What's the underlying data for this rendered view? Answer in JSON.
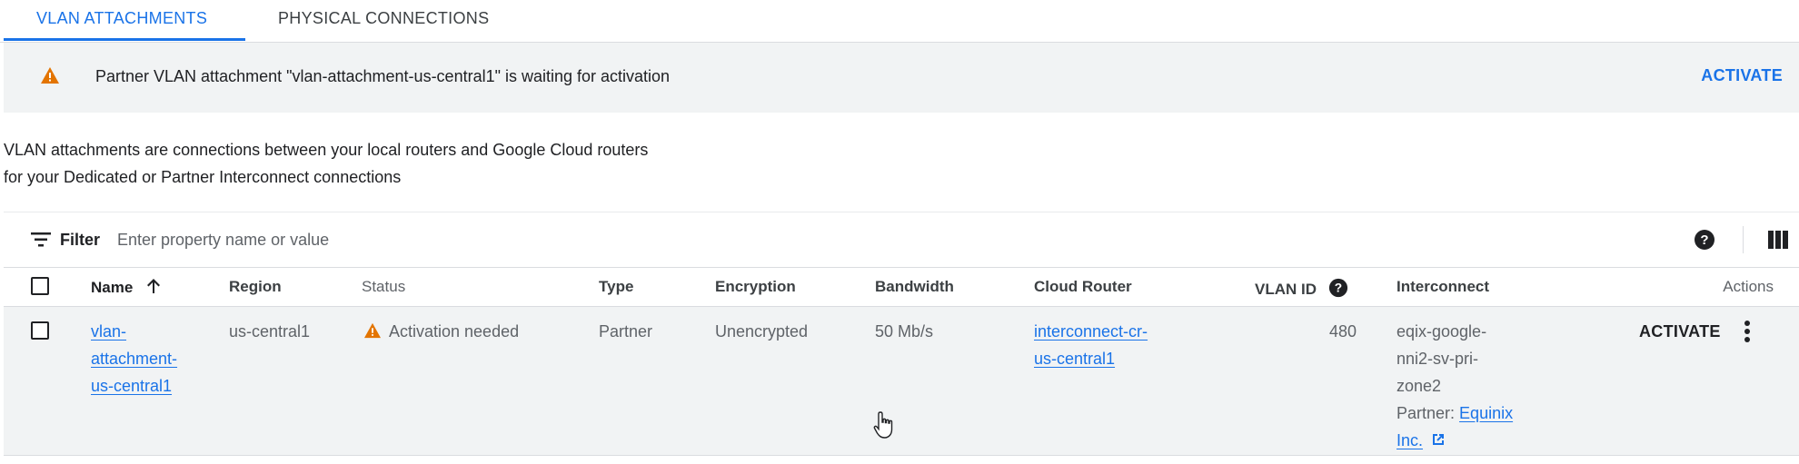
{
  "tabs": [
    {
      "label": "VLAN ATTACHMENTS",
      "active": true
    },
    {
      "label": "PHYSICAL CONNECTIONS",
      "active": false
    }
  ],
  "banner": {
    "icon": "warning-icon",
    "message": "Partner VLAN attachment \"vlan-attachment-us-central1\" is waiting for activation",
    "action_label": "ACTIVATE"
  },
  "description": {
    "line1": "VLAN attachments are connections between your local routers and Google Cloud routers",
    "line2": "for your Dedicated or Partner Interconnect connections"
  },
  "filter": {
    "label": "Filter",
    "placeholder": "Enter property name or value",
    "value": ""
  },
  "table": {
    "columns": {
      "name": "Name",
      "region": "Region",
      "status": "Status",
      "type": "Type",
      "encryption": "Encryption",
      "bandwidth": "Bandwidth",
      "cloud_router": "Cloud Router",
      "vlan_id": "VLAN ID",
      "interconnect": "Interconnect",
      "actions": "Actions"
    },
    "sort": {
      "column": "name",
      "direction": "ascending"
    },
    "rows": [
      {
        "name_lines": [
          "vlan-",
          "attachment-",
          "us-central1"
        ],
        "region": "us-central1",
        "status": "Activation needed",
        "type": "Partner",
        "encryption": "Unencrypted",
        "bandwidth": "50 Mb/s",
        "cloud_router_lines": [
          "interconnect-cr-",
          "us-central1"
        ],
        "vlan_id": "480",
        "interconnect_lines": [
          "eqix-google-",
          "nni2-sv-pri-",
          "zone2"
        ],
        "partner_label": "Partner:",
        "partner_name_lines": [
          "Equinix",
          "Inc."
        ],
        "action_label": "ACTIVATE"
      }
    ]
  },
  "colors": {
    "accent": "#1a73e8",
    "warning": "#e37400",
    "banner_bg": "#f1f3f4"
  }
}
